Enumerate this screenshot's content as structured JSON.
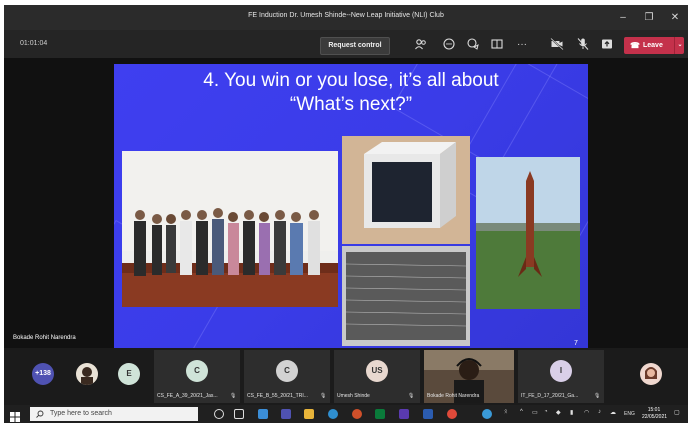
{
  "window": {
    "title": "FE Induction Dr. Umesh Shinde--New Leap Initiative (NLI) Club",
    "minimize": "–",
    "maximize": "❐",
    "close": "✕"
  },
  "toolbar": {
    "timer": "01:01:04",
    "request_control": "Request control",
    "more": "···",
    "leave": "Leave",
    "leave_dropdown": "⌄"
  },
  "slide": {
    "line1": "4. You win or you lose, it’s all about",
    "line2": "“What’s next?”",
    "page_number": "7"
  },
  "presenter_name": "Bokade Rohit Narendra",
  "participants": {
    "overflow_count": "+138",
    "tiles": [
      {
        "initial": "E",
        "name": ""
      },
      {
        "initial": "C",
        "name": "CS_FE_A_39_20/21_Jas..."
      },
      {
        "initial": "C",
        "name": "CS_FE_B_55_20/21_TRI..."
      },
      {
        "initial": "US",
        "name": "Umesh Shinde"
      },
      {
        "initial": "",
        "name": "Bokade Rohit Narendra"
      },
      {
        "initial": "I",
        "name": "IT_FE_D_17_20/21_Ga..."
      }
    ]
  },
  "taskbar": {
    "search_placeholder": "Type here to search",
    "language": "ENG",
    "time": "15:01",
    "date": "22/05/2021"
  },
  "colors": {
    "leave_red": "#c4314b",
    "slide_blue": "#3d3ee8",
    "avatar_green": "#cfe3d8",
    "avatar_blue": "#4f52b2"
  }
}
